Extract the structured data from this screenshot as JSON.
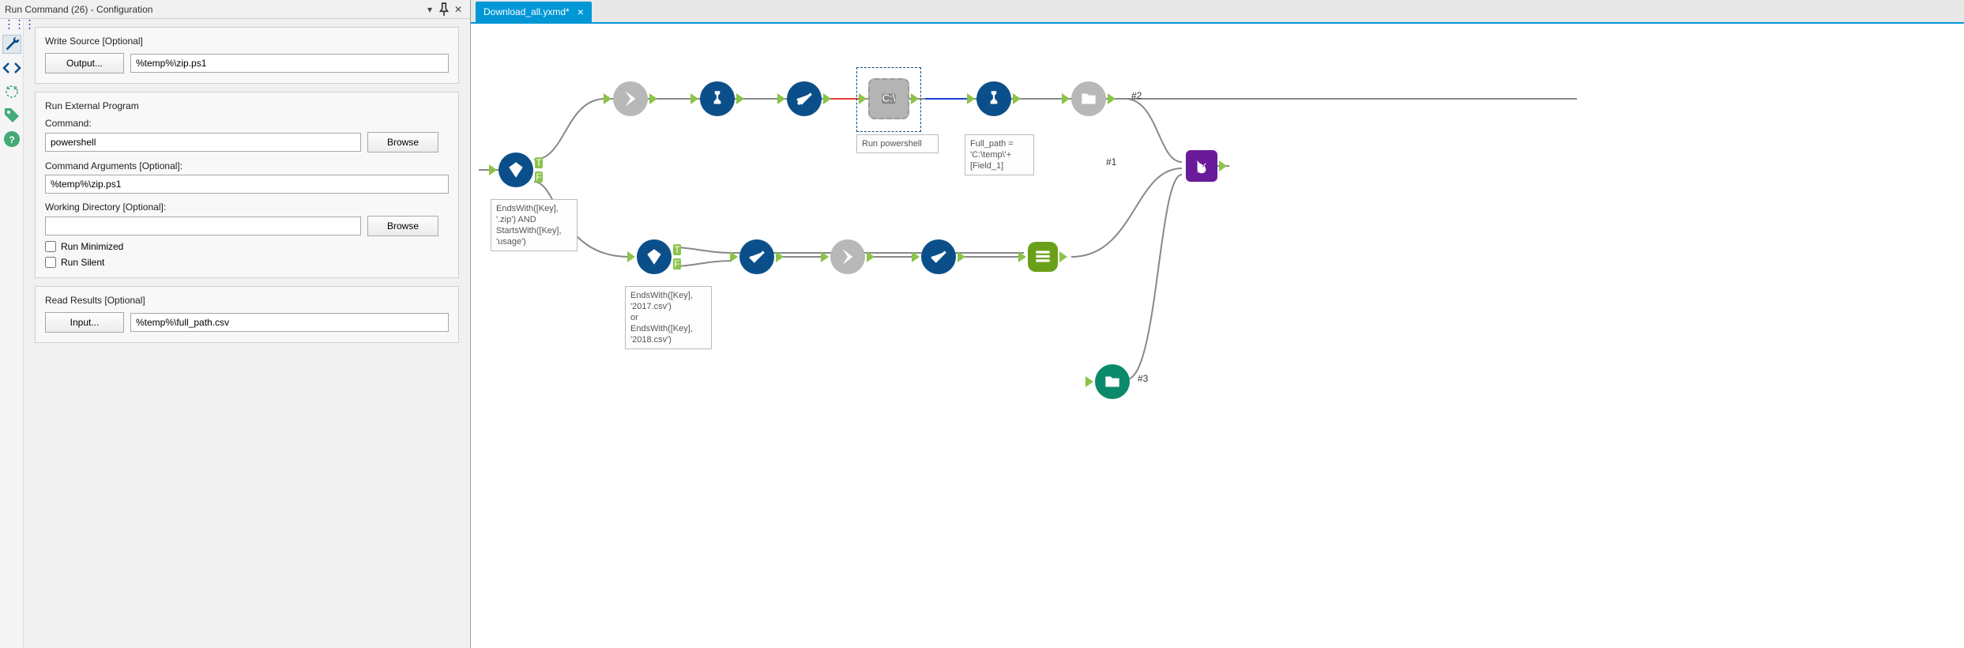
{
  "panel": {
    "title": "Run Command (26) - Configuration"
  },
  "form": {
    "write_source_label": "Write Source [Optional]",
    "output_btn": "Output...",
    "output_path": "%temp%\\zip.ps1",
    "group2_title": "Run External Program",
    "command_label": "Command:",
    "command_value": "powershell",
    "browse1": "Browse",
    "args_label": "Command Arguments [Optional]:",
    "args_value": "%temp%\\zip.ps1",
    "workdir_label": "Working Directory [Optional]:",
    "workdir_value": "",
    "browse2": "Browse",
    "run_min": "Run Minimized",
    "run_silent": "Run Silent",
    "read_results_label": "Read Results [Optional]",
    "input_btn": "Input...",
    "input_path": "%temp%\\full_path.csv"
  },
  "tabs": {
    "doc": "Download_all.yxmd*"
  },
  "captions": {
    "filter1": "EndsWith([Key],\n'.zip') AND\nStartsWith([Key],\n'usage')",
    "runps": "Run powershell",
    "fullpath": "Full_path =\n'C:\\temp\\'+\n[Field_1]",
    "filter2": "EndsWith([Key],\n'2017.csv')\nor\nEndsWith([Key],\n'2018.csv')"
  },
  "ports": {
    "p1": "#1",
    "p2": "#2",
    "p3": "#3"
  },
  "icons": {
    "wrench": "wrench-icon",
    "code": "code-icon",
    "target": "target-icon",
    "tag": "tag-icon",
    "help": "help-icon"
  }
}
